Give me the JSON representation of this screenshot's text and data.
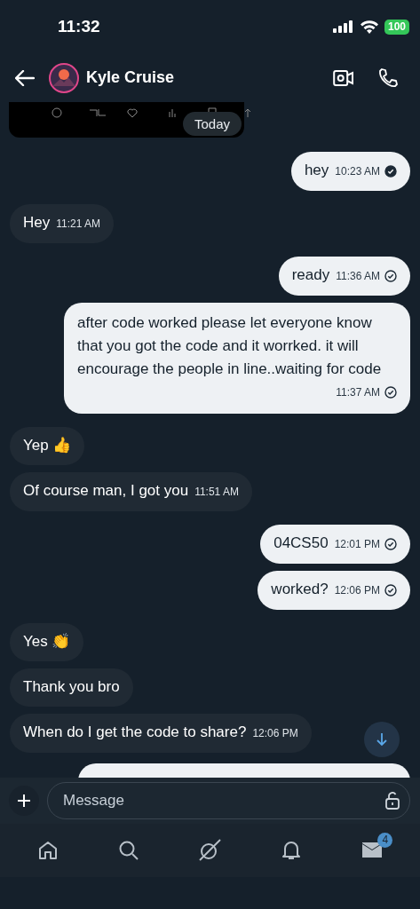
{
  "status_bar": {
    "time": "11:32",
    "battery": "100"
  },
  "header": {
    "title": "Kyle Cruise"
  },
  "shared_post": {
    "date_badge": "Today"
  },
  "messages": [
    {
      "kind": "sent",
      "text": "hey",
      "time": "10:23 AM",
      "read": true
    },
    {
      "kind": "received",
      "text": "Hey",
      "time": "11:21 AM"
    },
    {
      "kind": "sent",
      "text": "ready",
      "time": "11:36 AM",
      "read": false
    },
    {
      "kind": "sent",
      "text": "after code worked please let everyone know that you got the code and it worrked. it will encourage the people in line..waiting for code",
      "time": "11:37 AM",
      "read": false
    },
    {
      "kind": "received",
      "text": "Yep 👍"
    },
    {
      "kind": "received",
      "text": "Of course man, I got you",
      "time": "11:51 AM"
    },
    {
      "kind": "sent",
      "text": "04CS50",
      "time": "12:01 PM",
      "read": false
    },
    {
      "kind": "sent",
      "text": "worked?",
      "time": "12:06 PM",
      "read": false
    },
    {
      "kind": "received",
      "text": "Yes 👏"
    },
    {
      "kind": "received",
      "text": "Thank you bro"
    },
    {
      "kind": "received",
      "text": "When do I get the code to share?",
      "time": "12:06 PM"
    }
  ],
  "composer": {
    "placeholder": "Message"
  },
  "nav": [
    {
      "kind": "home"
    },
    {
      "kind": "search"
    },
    {
      "kind": "grok"
    },
    {
      "kind": "notifications"
    },
    {
      "kind": "messages",
      "badge": "4"
    }
  ]
}
